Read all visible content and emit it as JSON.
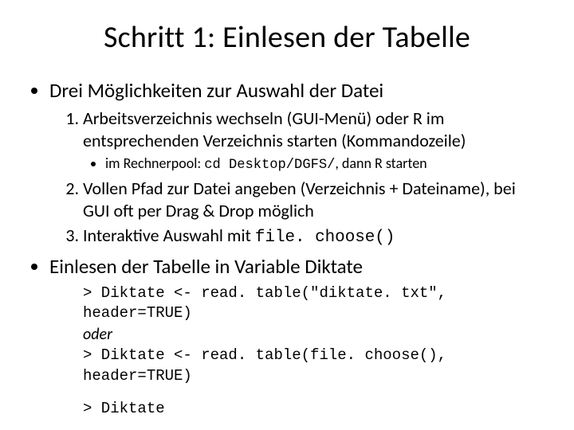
{
  "title": "Schritt 1: Einlesen der Tabelle",
  "bullets": {
    "b1": "Drei Möglichkeiten zur Auswahl der Datei",
    "b2": "Einlesen der Tabelle in Variable Diktate"
  },
  "nums": {
    "n1": "Arbeitsverzeichnis wechseln (GUI-Menü) oder R im entsprechenden Verzeichnis starten (Kommandozeile)",
    "n1_sub_pre": "im Rechnerpool: ",
    "n1_sub_code": "cd Desktop/DGFS/",
    "n1_sub_post": ", dann R starten",
    "n2": "Vollen Pfad zur Datei angeben (Verzeichnis + Dateiname), bei GUI oft per Drag & Drop möglich",
    "n3_pre": "Interaktive Auswahl mit ",
    "n3_code": "file. choose()"
  },
  "code": {
    "l1": "> Diktate <- read. table(\"diktate. txt\", header=TRUE)",
    "oder": "oder",
    "l2": "> Diktate <- read. table(file. choose(), header=TRUE)",
    "l3": "> Diktate"
  }
}
